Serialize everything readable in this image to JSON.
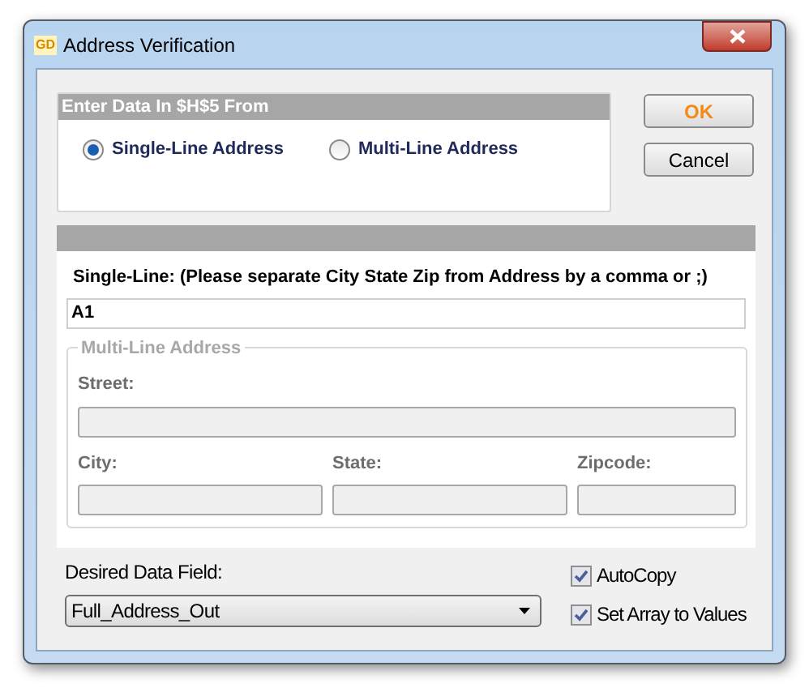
{
  "window": {
    "title": "Address Verification",
    "logo": "GD"
  },
  "source_group": {
    "title": "Enter Data In $H$5 From",
    "options": [
      {
        "label": "Single-Line Address",
        "selected": true
      },
      {
        "label": "Multi-Line Address",
        "selected": false
      }
    ]
  },
  "buttons": [
    {
      "label": "OK",
      "default": true
    },
    {
      "label": "Cancel",
      "default": false
    }
  ],
  "single_line": {
    "label": "Single-Line: (Please separate City State Zip from Address by a comma or ;)",
    "value": "A1"
  },
  "multi_line": {
    "title": "Multi-Line Address",
    "disabled": true,
    "street_label": "Street:",
    "fields": [
      {
        "label": "City:"
      },
      {
        "label": "State:"
      },
      {
        "label": "Zipcode:"
      }
    ]
  },
  "desired_field": {
    "label": "Desired Data Field:",
    "value": "Full_Address_Out"
  },
  "checkboxes": [
    {
      "label": "AutoCopy",
      "checked": true
    },
    {
      "label": "Set Array to Values",
      "checked": true
    }
  ]
}
